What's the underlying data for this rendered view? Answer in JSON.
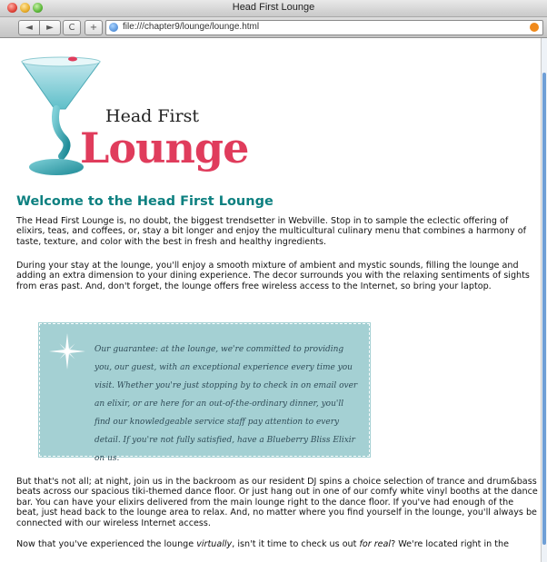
{
  "window": {
    "title": "Head First Lounge"
  },
  "toolbar": {
    "back": "◄",
    "forward": "►",
    "reload": "C",
    "add": "+",
    "url": "file:///chapter9/lounge/lounge.html"
  },
  "logo": {
    "head_first": "Head First",
    "lounge": "Lounge"
  },
  "heading": "Welcome to the Head First Lounge",
  "paragraphs": {
    "p1": "The Head First Lounge is, no doubt, the biggest trendsetter in Webville. Stop in to sample the eclectic offering of elixirs, teas, and coffees, or, stay a bit longer and enjoy the multicultural culinary menu that combines a harmony of taste, texture, and color with the best in fresh and healthy ingredients.",
    "p2": "During your stay at the lounge, you'll enjoy a smooth mixture of ambient and mystic sounds, filling the lounge and adding an extra dimension to your dining experience. The decor surrounds you with the relaxing sentiments of sights from eras past. And, don't forget, the lounge offers free wireless access to the Internet, so bring your laptop.",
    "p3": "But that's not all; at night, join us in the backroom as our resident DJ spins a choice selection of trance and drum&bass beats across our spacious tiki-themed dance floor. Or just hang out in one of our comfy white vinyl booths at the dance bar. You can have your elixirs delivered from the main lounge right to the dance floor. If you've had enough of the beat, just head back to the lounge area to relax. And, no matter where you find yourself in the lounge, you'll always be connected with our wireless Internet access.",
    "p4_a": "Now that you've experienced the lounge ",
    "p4_em1": "virtually",
    "p4_b": ", isn't it time to check us out ",
    "p4_em2": "for real",
    "p4_c": "? We're located right in the"
  },
  "guarantee": "Our guarantee: at the lounge, we're committed to providing you, our guest, with an exceptional experience every time you visit. Whether you're just stopping by to check in on email over an elixir, or are here for an out-of-the-ordinary dinner, you'll find our knowledgeable service staff pay attention to every detail. If you're not fully satisfied, have a Blueberry Bliss Elixir on us.",
  "colors": {
    "heading": "#0d8080",
    "guarantee_bg": "#a4d0d3",
    "logo_lounge": "#e03c5c"
  },
  "icons": [
    "close-button-icon",
    "minimize-button-icon",
    "zoom-button-icon",
    "back-icon",
    "forward-icon",
    "reload-icon",
    "globe-icon",
    "rss-icon",
    "martini-glass-icon",
    "sparkle-star-icon"
  ]
}
